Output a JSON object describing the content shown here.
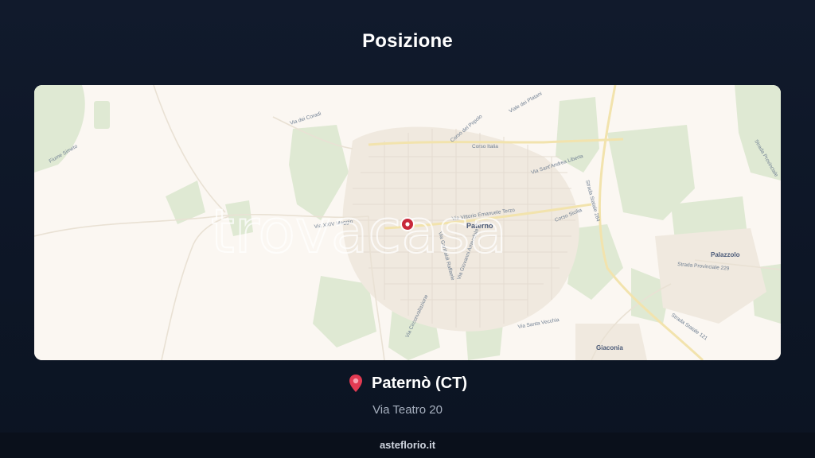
{
  "page": {
    "title": "Posizione"
  },
  "map": {
    "watermark": "trovacasa",
    "place_labels": {
      "paterno": "Paternò",
      "palazzolo": "Palazzolo",
      "giaconia": "Giaconia"
    },
    "street_labels": [
      "Via dei Coradi",
      "Fiume Simeto",
      "Corso del Popolo",
      "Viale dei Platani",
      "Corso Italia",
      "Via XXIV Maggio",
      "Via Sant'Andrea Liberta",
      "Via Vittorio Emanuele Terzo",
      "Corso Sicilia",
      "Via Garibaldi Raffaele",
      "Strada Statale 284",
      "Via Giovanni Amendola",
      "Strada Provinciale 229",
      "Via Circonvallazione",
      "Via Santa Vecchia",
      "Strada Statale 121",
      "Strada Provinciale"
    ],
    "colors": {
      "park": "#dfe9d3",
      "town": "#f1ebe2",
      "road": "#f3e6b4",
      "pin": "#c8283a"
    }
  },
  "location": {
    "pin_icon": "map-pin-icon",
    "city": "Paternò (CT)",
    "address": "Via Teatro 20"
  },
  "footer": {
    "site": "asteflorio.it"
  }
}
